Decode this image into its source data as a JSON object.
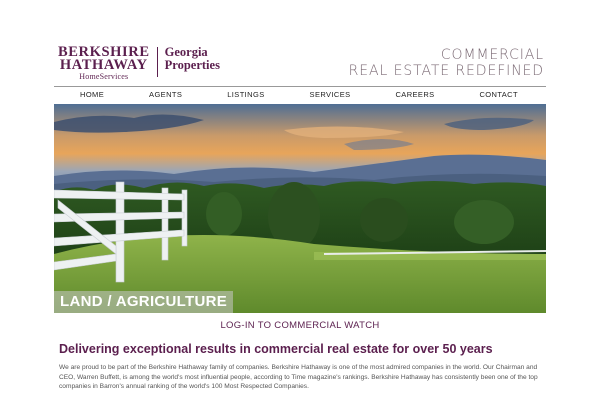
{
  "logo": {
    "line1": "BERKSHIRE",
    "line2": "HATHAWAY",
    "line3": "HomeServices",
    "right1": "Georgia",
    "right2": "Properties"
  },
  "tagline": {
    "line1": "COMMERCIAL",
    "line2": "REAL ESTATE REDEFINED"
  },
  "nav": {
    "items": [
      "HOME",
      "AGENTS",
      "LISTINGS",
      "SERVICES",
      "CAREERS",
      "CONTACT"
    ]
  },
  "hero": {
    "label": "LAND / AGRICULTURE"
  },
  "login_link": "LOG-IN TO COMMERCIAL WATCH",
  "headline": "Delivering exceptional results in commercial real estate for over 50 years",
  "body": "We are proud to be part of the Berkshire Hathaway family of companies. Berkshire Hathaway is one of the most admired companies in the world. Our Chairman and CEO, Warren Buffett, is among the world's most influential people, according to Time magazine's rankings. Berkshire Hathaway has consistently been one of the top companies in Barron's annual ranking of the world's 100 Most Respected Companies.",
  "colors": {
    "brand": "#5b1f4e",
    "tagline": "#7b6a74"
  }
}
